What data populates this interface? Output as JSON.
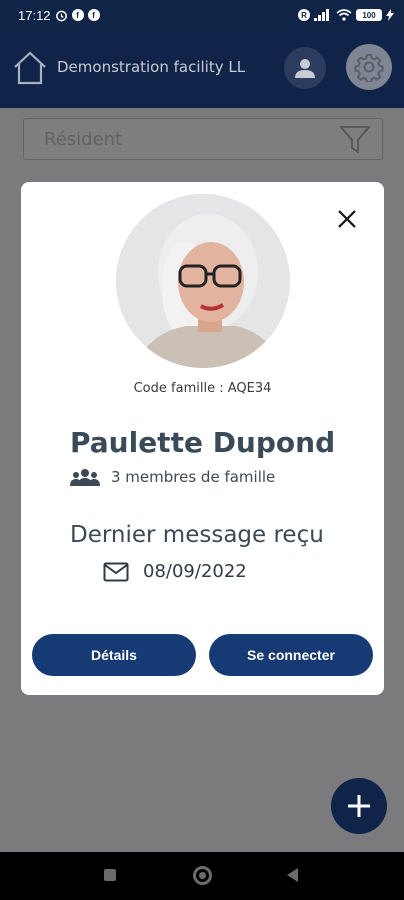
{
  "status_bar": {
    "time": "17:12",
    "battery": "100"
  },
  "header": {
    "facility_name": "Demonstration facility LL"
  },
  "search": {
    "placeholder": "Résident"
  },
  "modal": {
    "family_code": "Code famille : AQE34",
    "resident_name": "Paulette Dupond",
    "members_label": "3 membres de famille",
    "last_message_title": "Dernier message reçu",
    "last_message_date": "08/09/2022",
    "details_button": "Détails",
    "connect_button": "Se connecter"
  },
  "colors": {
    "primary": "#163a73",
    "header_bg": "#0f2448",
    "overlay": "#7b7b7d"
  },
  "icons": {
    "home": "home-icon",
    "user": "user-icon",
    "settings": "gear-icon",
    "filter": "filter-icon",
    "close": "close-icon",
    "members": "people-icon",
    "mail": "mail-icon",
    "add": "plus-icon"
  }
}
